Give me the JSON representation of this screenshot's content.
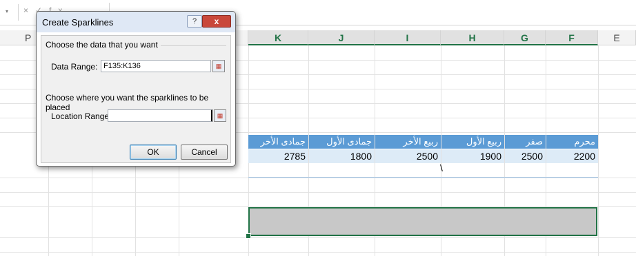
{
  "formula_bar": {
    "name_box_arrow": "▾",
    "icons": [
      "×",
      "✓",
      "fx"
    ]
  },
  "columns": [
    {
      "id": "P",
      "label": "P"
    },
    {
      "id": "K",
      "label": "K"
    },
    {
      "id": "J",
      "label": "J"
    },
    {
      "id": "I",
      "label": "I"
    },
    {
      "id": "H",
      "label": "H"
    },
    {
      "id": "G",
      "label": "G"
    },
    {
      "id": "F",
      "label": "F"
    },
    {
      "id": "E",
      "label": "E"
    }
  ],
  "table": {
    "headers": [
      "جمادى الأخر",
      "جمادى الأول",
      "ربيع الأخر",
      "ربيع الأول",
      "صفر",
      "محرم"
    ],
    "values": [
      "2785",
      "1800",
      "2500",
      "1900",
      "2500",
      "2200"
    ],
    "extra_text": "\\"
  },
  "dialog": {
    "title": "Create Sparklines",
    "help_label": "?",
    "close_label": "x",
    "data_section_label": "Choose the data that you want",
    "data_range_label": "Data Range:",
    "data_range_value": "F135:K136",
    "location_section_label": "Choose where you want the sparklines to be placed",
    "location_range_label": "Location Range:",
    "location_range_value": "",
    "ok_label": "OK",
    "cancel_label": "Cancel"
  },
  "colors": {
    "table_header": "#5b9bd5",
    "table_row": "#ddebf7",
    "selection_border": "#217346",
    "selection_fill": "#c8c8c8"
  }
}
